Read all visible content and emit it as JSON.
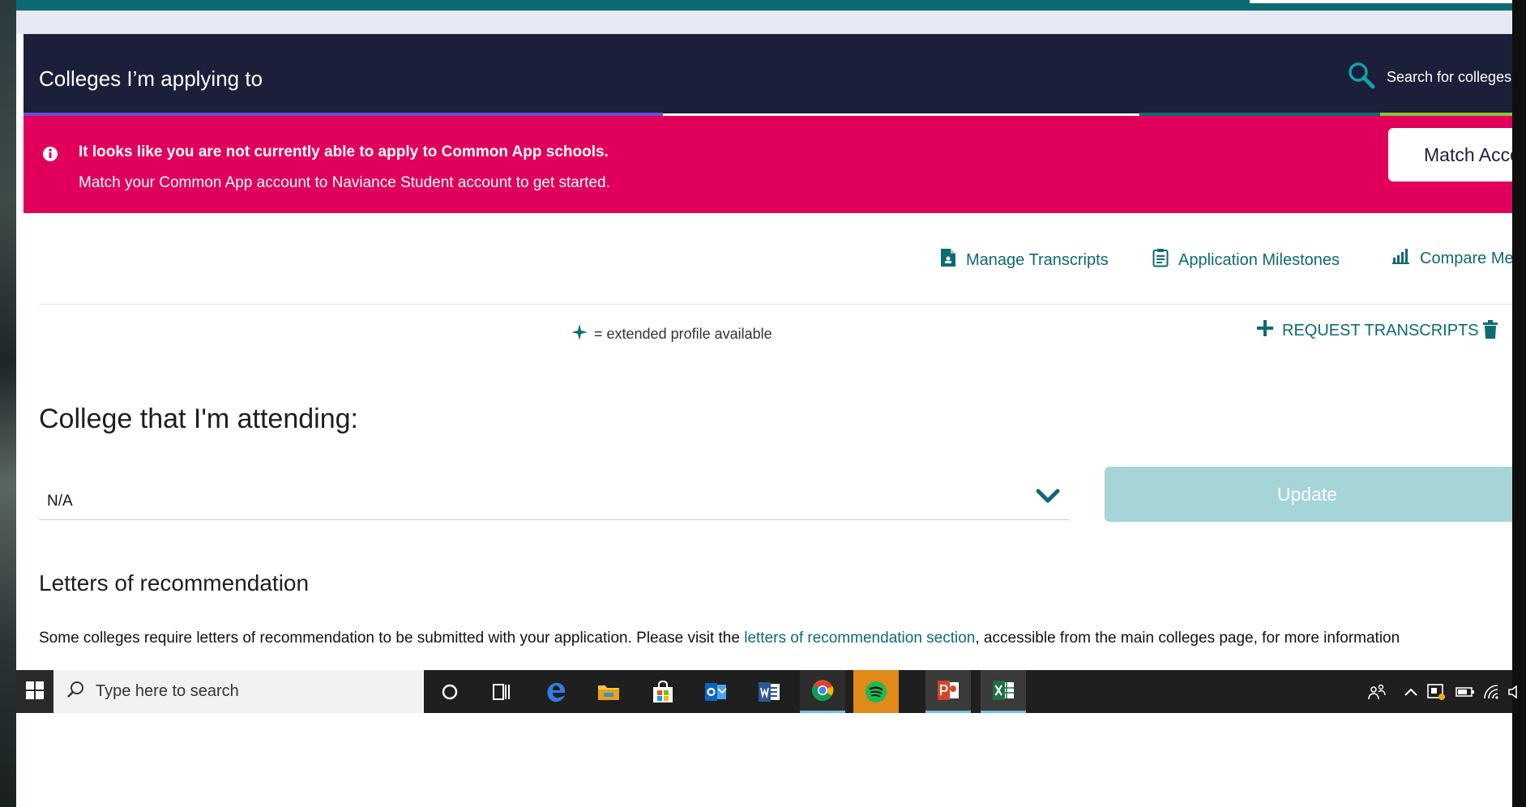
{
  "header": {
    "title": "Colleges I’m applying to",
    "search_label": "Search for colleges"
  },
  "banner": {
    "line1": "It looks like you are not currently able to apply to Common App schools.",
    "line2": "Match your Common App account to Naviance Student account to get started.",
    "match_button": "Match Accounts"
  },
  "quicklinks": {
    "manage_transcripts": "Manage Transcripts",
    "application_milestones": "Application Milestones",
    "compare": "Compare Me"
  },
  "legend": {
    "text": "= extended profile available"
  },
  "request_transcripts": "REQUEST TRANSCRIPTS",
  "attending": {
    "heading": "College that I'm attending:",
    "selected_value": "N/A",
    "update_button": "Update"
  },
  "letters": {
    "heading": "Letters of recommendation",
    "text_before": "Some colleges require letters of recommendation to be submitted with your application. Please visit the ",
    "link": "letters of recommendation section",
    "text_after": ", accessible from the main colleges page, for more information"
  },
  "taskbar": {
    "search_placeholder": "Type here to search"
  },
  "colors": {
    "header_bg": "#1b1f3a",
    "banner_bg": "#e0005b",
    "accent_teal": "#0e6a72",
    "update_button_bg": "#a5d5d6"
  }
}
